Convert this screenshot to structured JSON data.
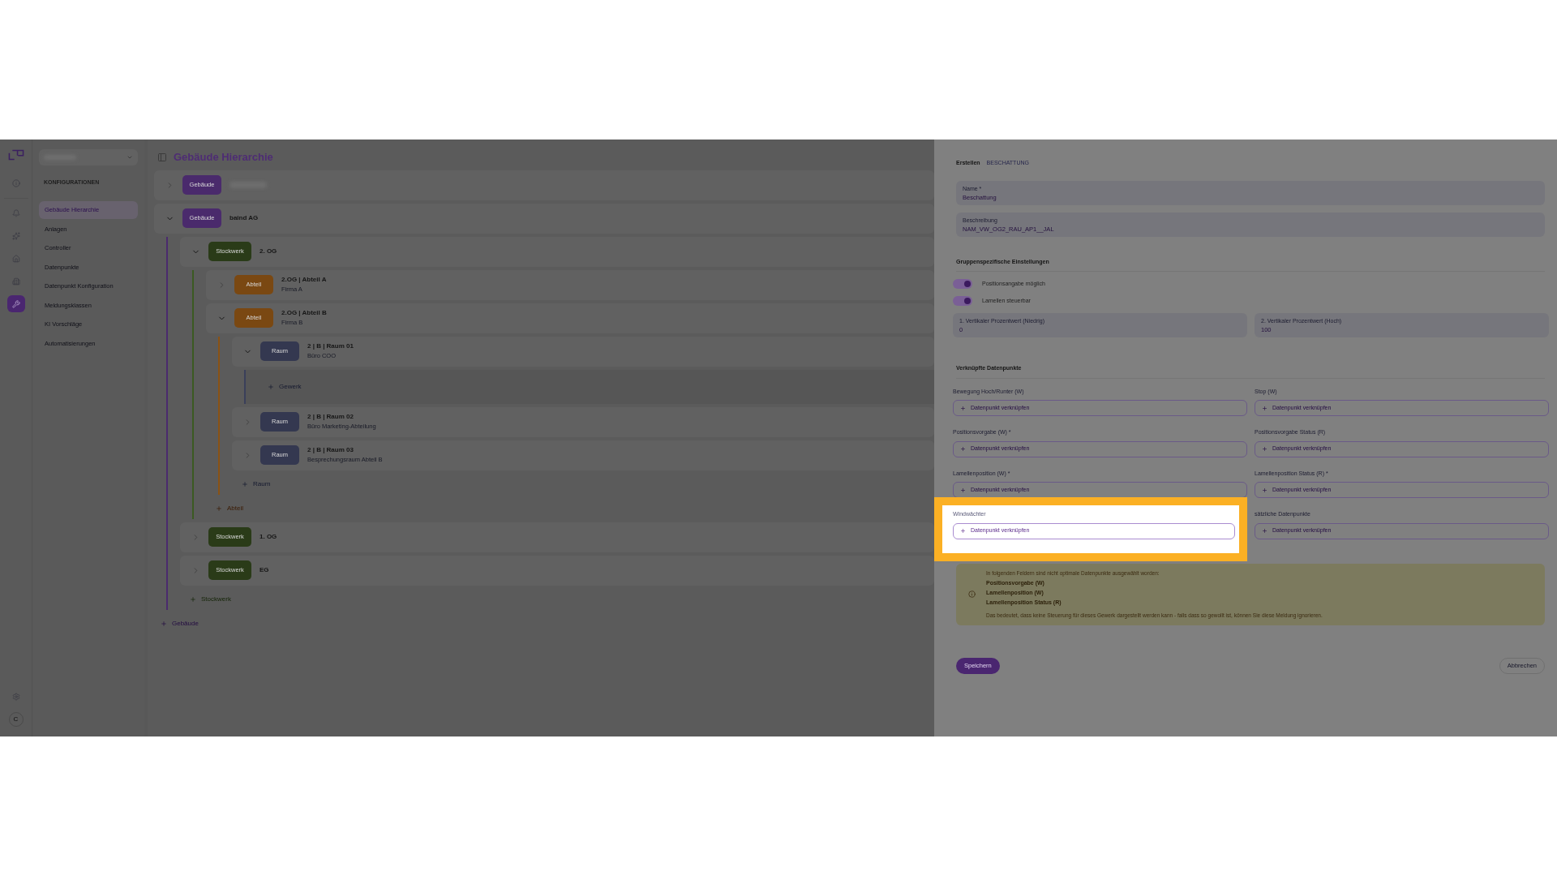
{
  "rail": {
    "avatar": "C",
    "items": [
      {
        "kind": "info",
        "selected": false
      },
      {
        "kind": "bell",
        "selected": false
      },
      {
        "kind": "sparkles",
        "selected": false
      },
      {
        "kind": "house",
        "selected": false
      },
      {
        "kind": "building",
        "selected": false
      },
      {
        "kind": "wrench",
        "selected": true
      }
    ]
  },
  "sidebar": {
    "heading": "KONFIGURATIONEN",
    "items": [
      {
        "label": "Gebäude Hierarchie",
        "selected": true
      },
      {
        "label": "Anlagen",
        "selected": false
      },
      {
        "label": "Controller",
        "selected": false
      },
      {
        "label": "Datenpunkte",
        "selected": false
      },
      {
        "label": "Datenpunkt Konfiguration",
        "selected": false
      },
      {
        "label": "Meldungsklassen",
        "selected": false
      },
      {
        "label": "KI Vorschläge",
        "selected": false
      },
      {
        "label": "Automatisierungen",
        "selected": false
      }
    ]
  },
  "main": {
    "title": "Gebäude Hierarchie",
    "add_label": "Gebäude",
    "tree": [
      {
        "kind": "building",
        "badge": "Gebäude",
        "redacted": true,
        "expanded": false
      },
      {
        "kind": "building",
        "badge": "Gebäude",
        "name": "baind AG",
        "expanded": true,
        "add_label": "Stockwerk",
        "children": [
          {
            "kind": "floor",
            "badge": "Stockwerk",
            "name": "2. OG",
            "expanded": true,
            "add_label": "Abteil",
            "children": [
              {
                "kind": "section",
                "badge": "Abteil",
                "name": "2.OG | Abteil A",
                "subtitle": "Firma A",
                "expanded": false
              },
              {
                "kind": "section",
                "badge": "Abteil",
                "name": "2.OG | Abteil B",
                "subtitle": "Firma B",
                "expanded": true,
                "add_label": "Raum",
                "children": [
                  {
                    "kind": "room",
                    "badge": "Raum",
                    "name": "2 | B | Raum 01",
                    "subtitle": "Büro COO",
                    "expanded": true,
                    "add_label": "Gewerk"
                  },
                  {
                    "kind": "room",
                    "badge": "Raum",
                    "name": "2 | B | Raum 02",
                    "subtitle": "Büro Marketing-Abteilung",
                    "expanded": false
                  },
                  {
                    "kind": "room",
                    "badge": "Raum",
                    "name": "2 | B | Raum 03",
                    "subtitle": "Besprechungsraum Abteil B",
                    "expanded": false
                  }
                ]
              }
            ]
          },
          {
            "kind": "floor",
            "badge": "Stockwerk",
            "name": "1. OG",
            "expanded": false
          },
          {
            "kind": "floor",
            "badge": "Stockwerk",
            "name": "EG",
            "expanded": false
          }
        ]
      }
    ]
  },
  "panel": {
    "breadcrumb": [
      "Erstellen",
      "BESCHATTUNG"
    ],
    "fields": [
      {
        "label": "Name *",
        "value": "Beschattung"
      },
      {
        "label": "Beschreibung",
        "value": "NAM_VW_OG2_RAU_AP1__JAL"
      }
    ],
    "group_heading": "Gruppenspezifische Einstellungen",
    "toggles": [
      {
        "label": "Positionsangabe möglich",
        "on": true
      },
      {
        "label": "Lamellen steuerbar",
        "on": true
      }
    ],
    "percent_fields": [
      {
        "label": "1. Vertikaler Prozentwert (Niedrig)",
        "value": "0"
      },
      {
        "label": "2. Vertikaler Prozentwert (Hoch)",
        "value": "100"
      }
    ],
    "links_heading": "Verknüpfte Datenpunkte",
    "links": [
      {
        "label": "Bewegung Hoch/Runter (W)",
        "button": "Datenpunkt verknüpfen",
        "highlighted": false
      },
      {
        "label": "Stop (W)",
        "button": "Datenpunkt verknüpfen",
        "highlighted": false
      },
      {
        "label": "Positionsvorgabe (W) *",
        "button": "Datenpunkt verknüpfen",
        "highlighted": false
      },
      {
        "label": "Positionsvorgabe Status (R)",
        "button": "Datenpunkt verknüpfen",
        "highlighted": false
      },
      {
        "label": "Lamellenposition (W) *",
        "button": "Datenpunkt verknüpfen",
        "highlighted": false
      },
      {
        "label": "Lamellenposition Status (R) *",
        "button": "Datenpunkt verknüpfen",
        "highlighted": false
      },
      {
        "label": "Windwächter",
        "button": "Datenpunkt verknüpfen",
        "highlighted": true
      },
      {
        "label": "sätzliche Datenpunkte",
        "button": "Datenpunkt verknüpfen",
        "highlighted": false
      }
    ],
    "warning": {
      "intro": "In folgenden Feldern sind nicht optimale Datenpunkte ausgewählt worden:",
      "items": [
        "Positionsvorgabe (W)",
        "Lamellenposition (W)",
        "Lamellenposition Status (R)"
      ],
      "note": "Das bedeutet, dass keine Steuerung für dieses Gewerk dargestellt werden kann - falls dass so gewollt ist, können Sie diese Meldung ignorieren."
    },
    "save": "Speichern",
    "cancel": "Abbrechen"
  }
}
